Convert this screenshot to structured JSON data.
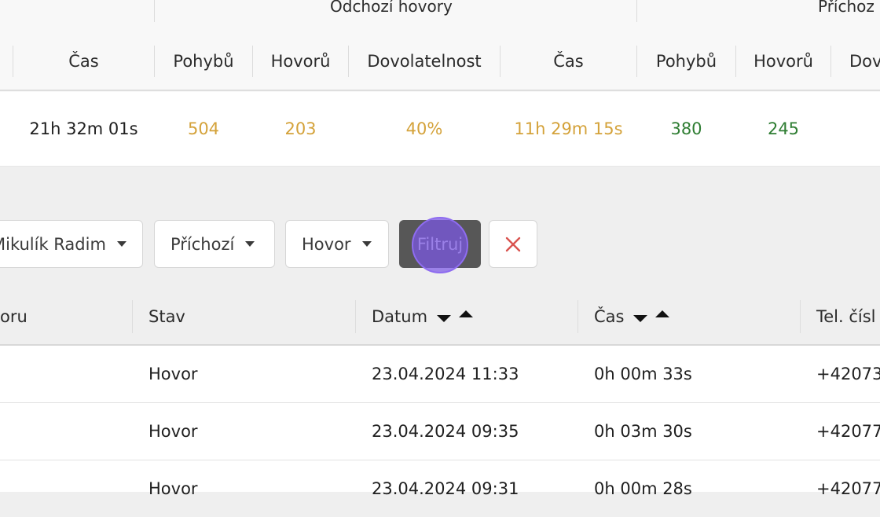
{
  "summary": {
    "group_outgoing": "Odchozí hovory",
    "group_incoming_partial": "Příchoz",
    "headers": [
      "Čas",
      "Pohybů",
      "Hovorů",
      "Dovolatelnost",
      "Čas",
      "Pohybů",
      "Hovorů",
      "Dov"
    ],
    "values": {
      "total_time": "21h 32m 01s",
      "out_moves": "504",
      "out_calls": "203",
      "out_reach": "40%",
      "out_time": "11h 29m 15s",
      "in_moves": "380",
      "in_calls": "245"
    },
    "colors": {
      "outgoing_value": "#d4a23a",
      "incoming_value": "#2e7d32",
      "clear_icon": "#d9534f",
      "click_marker": "#7c58e6"
    }
  },
  "filters": {
    "user": "Mikulík Radim",
    "direction": "Příchozí",
    "type": "Hovor",
    "apply_label": "Filtruj",
    "clear_icon": "close-icon"
  },
  "table": {
    "columns": {
      "first_partial": "oru",
      "status": "Stav",
      "date": "Datum",
      "time": "Čas",
      "phone_partial": "Tel. čísl"
    },
    "rows": [
      {
        "status": "Hovor",
        "date": "23.04.2024 11:33",
        "time": "0h 00m 33s",
        "phone": "+42073"
      },
      {
        "status": "Hovor",
        "date": "23.04.2024 09:35",
        "time": "0h 03m 30s",
        "phone": "+42077"
      },
      {
        "status": "Hovor",
        "date": "23.04.2024 09:31",
        "time": "0h 00m 28s",
        "phone": "+42077"
      }
    ]
  }
}
